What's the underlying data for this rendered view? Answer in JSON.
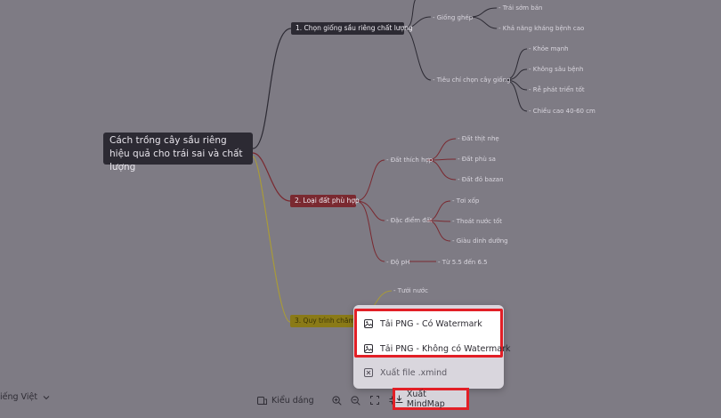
{
  "mindmap": {
    "root": "Cách trồng cây sầu riêng hiệu quả cho trái sai và chất lượng",
    "branch1": {
      "label": "1. Chọn giống sầu riêng chất lượng",
      "sub": [
        {
          "label": "- Giống ghép",
          "leaves": [
            "- Trái sớm bán",
            "- Khả năng kháng bệnh cao"
          ]
        },
        {
          "label": "- Tiêu chí chọn cây giống",
          "leaves": [
            "- Khỏe mạnh",
            "- Không sâu bệnh",
            "- Rễ phát triển tốt",
            "- Chiều cao 40-60 cm"
          ]
        }
      ]
    },
    "branch2": {
      "label": "2. Loại đất phù hợp",
      "sub": [
        {
          "label": "- Đất thích hợp",
          "leaves": [
            "- Đất thịt nhẹ",
            "- Đất phù sa",
            "- Đất đỏ bazan"
          ]
        },
        {
          "label": "- Đặc điểm đất",
          "leaves": [
            "- Tơi xốp",
            "- Thoát nước tốt",
            "- Giàu dinh dưỡng"
          ]
        },
        {
          "label": "- Độ pH",
          "leaves": [
            "- Từ 5.5 đến 6.5"
          ]
        }
      ]
    },
    "branch3": {
      "label": "3. Quy trình chăm",
      "sub": [
        {
          "label": "- Tưới nước"
        }
      ]
    }
  },
  "export_menu": {
    "items": [
      "Tải PNG - Có Watermark",
      "Tải PNG - Không có Watermark",
      "Xuất file .xmind"
    ]
  },
  "toolbar": {
    "language": "iếng Việt",
    "style": "Kiểu dáng",
    "export": "Xuất MindMap"
  },
  "colors": {
    "highlight": "#e21f26",
    "branch1": "#2c2a33",
    "branch2": "#7a2930",
    "branch3": "#8a7a17"
  }
}
